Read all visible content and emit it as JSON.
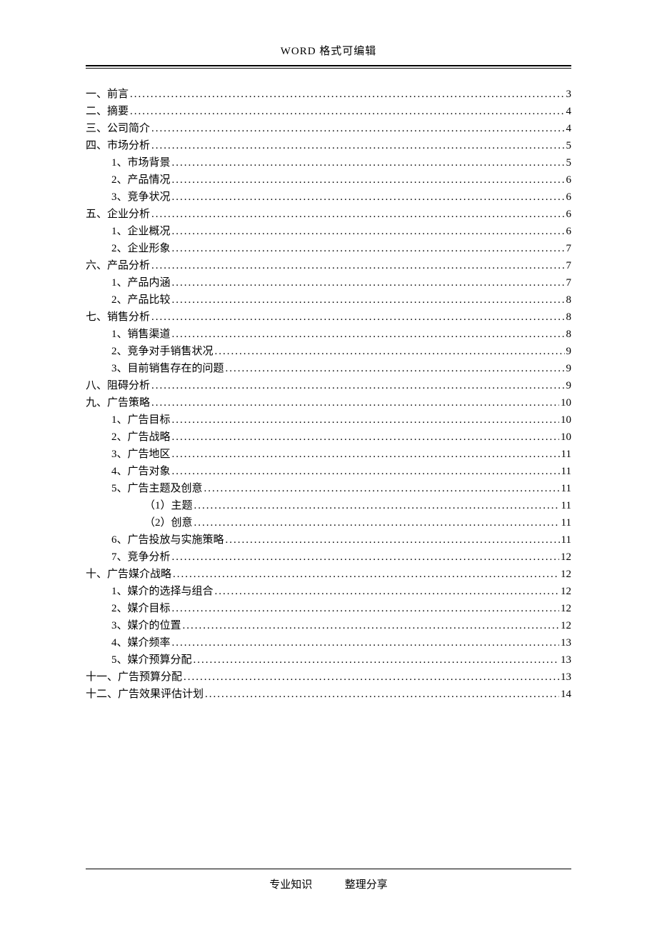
{
  "header": {
    "title": "WORD 格式可编辑"
  },
  "footer": {
    "left": "专业知识",
    "right": "整理分享"
  },
  "toc": [
    {
      "label": "一、前言",
      "page": "3",
      "indent": 0
    },
    {
      "label": "二、摘要",
      "page": "4",
      "indent": 0
    },
    {
      "label": "三、公司简介",
      "page": "4",
      "indent": 0
    },
    {
      "label": "四、市场分析",
      "page": "5",
      "indent": 0
    },
    {
      "label": "1、市场背景",
      "page": "5",
      "indent": 1
    },
    {
      "label": "2、产品情况",
      "page": "6",
      "indent": 1
    },
    {
      "label": "3、竞争状况",
      "page": "6",
      "indent": 1
    },
    {
      "label": "五、企业分析",
      "page": "6",
      "indent": 0
    },
    {
      "label": "1、企业概况",
      "page": "6",
      "indent": 1
    },
    {
      "label": "2、企业形象",
      "page": "7",
      "indent": 1
    },
    {
      "label": "六、产品分析",
      "page": "7",
      "indent": 0
    },
    {
      "label": "1、产品内涵",
      "page": "7",
      "indent": 1
    },
    {
      "label": "2、产品比较",
      "page": "8",
      "indent": 1
    },
    {
      "label": "七、销售分析",
      "page": "8",
      "indent": 0
    },
    {
      "label": "1、销售渠道",
      "page": "8",
      "indent": 1
    },
    {
      "label": "2、竞争对手销售状况",
      "page": "9",
      "indent": 1
    },
    {
      "label": "3、目前销售存在的问题",
      "page": "9",
      "indent": 1
    },
    {
      "label": "八、阻碍分析",
      "page": "9",
      "indent": 0
    },
    {
      "label": "九、广告策略",
      "page": "10",
      "indent": 0
    },
    {
      "label": "1、广告目标",
      "page": "10",
      "indent": 1
    },
    {
      "label": "2、广告战略",
      "page": "10",
      "indent": 1
    },
    {
      "label": "3、广告地区",
      "page": "11",
      "indent": 1
    },
    {
      "label": "4、广告对象",
      "page": "11",
      "indent": 1
    },
    {
      "label": "5、广告主题及创意",
      "page": "11",
      "indent": 1
    },
    {
      "label": "（1）主题",
      "page": "11",
      "indent": 2
    },
    {
      "label": "（2）创意",
      "page": "11",
      "indent": 2
    },
    {
      "label": "6、广告投放与实施策略",
      "page": "11",
      "indent": 1
    },
    {
      "label": "7、竞争分析",
      "page": "12",
      "indent": 1
    },
    {
      "label": "十、广告媒介战略",
      "page": "12",
      "indent": 0
    },
    {
      "label": "1、媒介的选择与组合",
      "page": "12",
      "indent": 1
    },
    {
      "label": "2、媒介目标",
      "page": "12",
      "indent": 1
    },
    {
      "label": "3、媒介的位置",
      "page": "12",
      "indent": 1
    },
    {
      "label": "4、媒介频率",
      "page": "13",
      "indent": 1
    },
    {
      "label": "5、媒介预算分配",
      "page": "13",
      "indent": 1
    },
    {
      "label": "十一、广告预算分配",
      "page": "13",
      "indent": 0
    },
    {
      "label": "十二、广告效果评估计划",
      "page": "14",
      "indent": 0
    }
  ]
}
